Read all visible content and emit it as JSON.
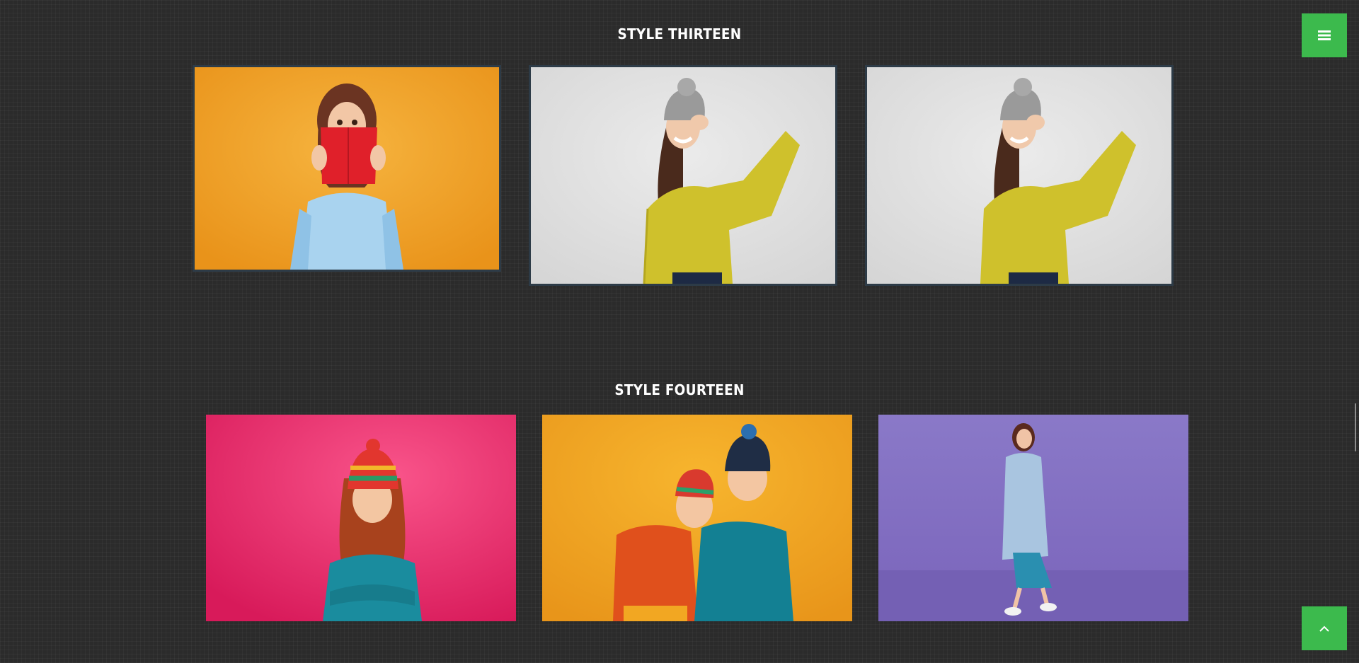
{
  "sections": [
    {
      "title": "STYLE THIRTEEN"
    },
    {
      "title": "STYLE FOURTEEN"
    }
  ],
  "photos": {
    "s13_1": {
      "bg": "#f3a52a",
      "subject": "woman-with-red-book"
    },
    "s13_2": {
      "bg": "#e0e0e0",
      "subject": "woman-yellow-sweater"
    },
    "s13_3": {
      "bg": "#e0e0e0",
      "subject": "woman-yellow-sweater"
    },
    "s14_1": {
      "bg": "#ee3f78",
      "subject": "girl-knit-hat"
    },
    "s14_2": {
      "bg": "#f1a826",
      "subject": "two-kids"
    },
    "s14_3": {
      "bg": "#8470c2",
      "subject": "woman-coat"
    }
  },
  "buttons": {
    "menu_icon": "menu-icon",
    "top_icon": "chevron-up-icon"
  },
  "colors": {
    "accent": "#3cba4d",
    "background": "#2b2b2b",
    "card_border": "#2d3b47"
  }
}
